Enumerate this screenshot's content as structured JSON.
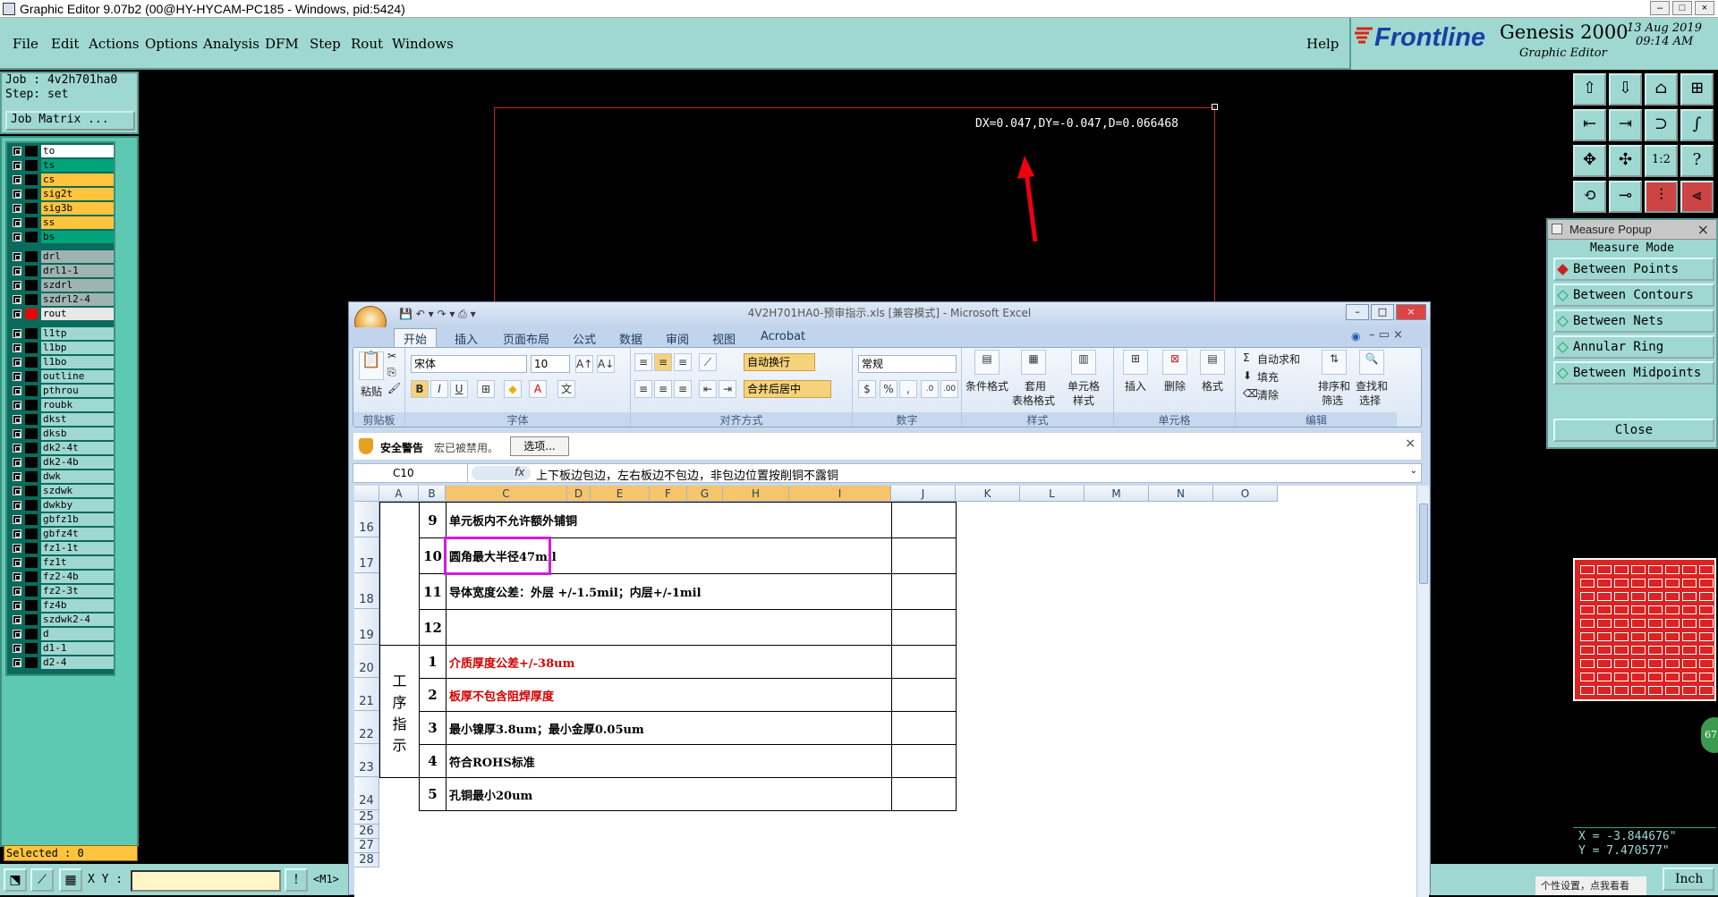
{
  "window": {
    "title": "Graphic Editor 9.07b2 (00@HY-HYCAM-PC185 - Windows, pid:5424)"
  },
  "menu": {
    "items": [
      "File",
      "Edit",
      "Actions",
      "Options",
      "Analysis",
      "DFM",
      "Step",
      "Rout",
      "Windows"
    ],
    "help": "Help"
  },
  "brand": {
    "logo": "Frontline",
    "product": "Genesis 2000",
    "subtitle": "Graphic Editor",
    "date": "13 Aug 2019",
    "time": "09:14 AM"
  },
  "job": {
    "job_line": "Job : 4v2h701ha0",
    "step_line": "Step: set",
    "matrix_button": "Job Matrix ..."
  },
  "layers": [
    {
      "name": "to",
      "bg": "#ffffff"
    },
    {
      "name": "ts",
      "bg": "#00a37a"
    },
    {
      "name": "cs",
      "bg": "#ffc43d"
    },
    {
      "name": "sig2t",
      "bg": "#ffc43d"
    },
    {
      "name": "sig3b",
      "bg": "#ffc43d"
    },
    {
      "name": "ss",
      "bg": "#ffc43d"
    },
    {
      "name": "bs",
      "bg": "#00a37a"
    },
    {
      "name": "drl",
      "bg": "#9fb4b2"
    },
    {
      "name": "drl1-1",
      "bg": "#9fb4b2"
    },
    {
      "name": "szdrl",
      "bg": "#9fb4b2"
    },
    {
      "name": "szdrl2-4",
      "bg": "#9fb4b2"
    },
    {
      "name": "rout",
      "bg": "#e8e8e8"
    },
    {
      "name": "l1tp",
      "bg": "#9ed8d1"
    },
    {
      "name": "l1bp",
      "bg": "#9ed8d1"
    },
    {
      "name": "l1bo",
      "bg": "#9ed8d1"
    },
    {
      "name": "outline",
      "bg": "#9ed8d1"
    },
    {
      "name": "pthrou",
      "bg": "#9ed8d1"
    },
    {
      "name": "roubk",
      "bg": "#9ed8d1"
    },
    {
      "name": "dkst",
      "bg": "#9ed8d1"
    },
    {
      "name": "dksb",
      "bg": "#9ed8d1"
    },
    {
      "name": "dk2-4t",
      "bg": "#9ed8d1"
    },
    {
      "name": "dk2-4b",
      "bg": "#9ed8d1"
    },
    {
      "name": "dwk",
      "bg": "#9ed8d1"
    },
    {
      "name": "szdwk",
      "bg": "#9ed8d1"
    },
    {
      "name": "dwkby",
      "bg": "#9ed8d1"
    },
    {
      "name": "gbfz1b",
      "bg": "#9ed8d1"
    },
    {
      "name": "gbfz4t",
      "bg": "#9ed8d1"
    },
    {
      "name": "fz1-1t",
      "bg": "#9ed8d1"
    },
    {
      "name": "fz1t",
      "bg": "#9ed8d1"
    },
    {
      "name": "fz2-4b",
      "bg": "#9ed8d1"
    },
    {
      "name": "fz2-3t",
      "bg": "#9ed8d1"
    },
    {
      "name": "fz4b",
      "bg": "#9ed8d1"
    },
    {
      "name": "szdwk2-4",
      "bg": "#9ed8d1"
    },
    {
      "name": "d",
      "bg": "#9ed8d1"
    },
    {
      "name": "d1-1",
      "bg": "#9ed8d1"
    },
    {
      "name": "d2-4",
      "bg": "#9ed8d1"
    }
  ],
  "status": {
    "selected": "Selected : 0",
    "xy_label": "X Y :",
    "m1": "<M1>"
  },
  "canvas": {
    "measure_text": "DX=0.047,DY=-0.047,D=0.066468"
  },
  "measure": {
    "title": "Measure Popup",
    "mode_label": "Measure Mode",
    "options": [
      "Between Points",
      "Between Contours",
      "Between Nets",
      "Annular Ring",
      "Between Midpoints"
    ],
    "close": "Close"
  },
  "readout": {
    "x": "X = -3.844676\"",
    "y": "Y = 7.470577\"",
    "units": "Inch",
    "taskbar_hint": "个性设置，点我看看",
    "badge": "67"
  },
  "excel": {
    "title": "4V2H701HA0-预审指示.xls [兼容模式] - Microsoft Excel",
    "tabs": [
      "开始",
      "插入",
      "页面布局",
      "公式",
      "数据",
      "审阅",
      "视图",
      "Acrobat"
    ],
    "groups": {
      "clipboard": "剪贴板",
      "font": "字体",
      "align": "对齐方式",
      "number": "数字",
      "styles": "样式",
      "cells": "单元格",
      "edit": "编辑"
    },
    "paste": "粘贴",
    "font_name": "宋体",
    "font_size": "10",
    "wrap": "自动换行",
    "merge": "合并后居中",
    "num_format": "常规",
    "cond_format": "条件格式",
    "table_format_1": "套用",
    "table_format_2": "表格格式",
    "cell_style_1": "单元格",
    "cell_style_2": "样式",
    "insert": "插入",
    "delete": "删除",
    "format": "格式",
    "autosum": "自动求和",
    "fill": "填充",
    "clear": "清除",
    "sort_1": "排序和",
    "sort_2": "筛选",
    "find_1": "查找和",
    "find_2": "选择",
    "security_title": "安全警告",
    "security_msg": "宏已被禁用。",
    "security_btn": "选项...",
    "namebox": "C10",
    "formula": "上下板边包边，左右板边不包边，非包边位置按削铜不露铜",
    "fx": "fx",
    "columns": [
      "A",
      "B",
      "C",
      "D",
      "E",
      "F",
      "G",
      "H",
      "I",
      "J",
      "K",
      "L",
      "M",
      "N",
      "O"
    ],
    "section_label": "工序指示",
    "rows": [
      {
        "row": "16",
        "num": "9",
        "text": "单元板内不允许额外铺铜",
        "color": "#000000"
      },
      {
        "row": "17",
        "num": "10",
        "text": "圆角最大半径47mil",
        "color": "#000000"
      },
      {
        "row": "18",
        "num": "11",
        "text": "导体宽度公差：外层 +/-1.5mil；内层+/-1mil",
        "color": "#000000"
      },
      {
        "row": "19",
        "num": "12",
        "text": "",
        "color": "#000000"
      },
      {
        "row": "20",
        "num": "1",
        "text": "介质厚度公差+/-38um",
        "color": "#d40000"
      },
      {
        "row": "21",
        "num": "2",
        "text": "板厚不包含阻焊厚度",
        "color": "#d40000"
      },
      {
        "row": "22",
        "num": "3",
        "text": "最小镍厚3.8um；最小金厚0.05um",
        "color": "#000000"
      },
      {
        "row": "23",
        "num": "4",
        "text": "符合ROHS标准",
        "color": "#000000"
      },
      {
        "row": "24",
        "num": "5",
        "text": "孔铜最小20um",
        "color": "#000000"
      }
    ],
    "empty_rows": [
      "25",
      "26",
      "27",
      "28"
    ]
  }
}
